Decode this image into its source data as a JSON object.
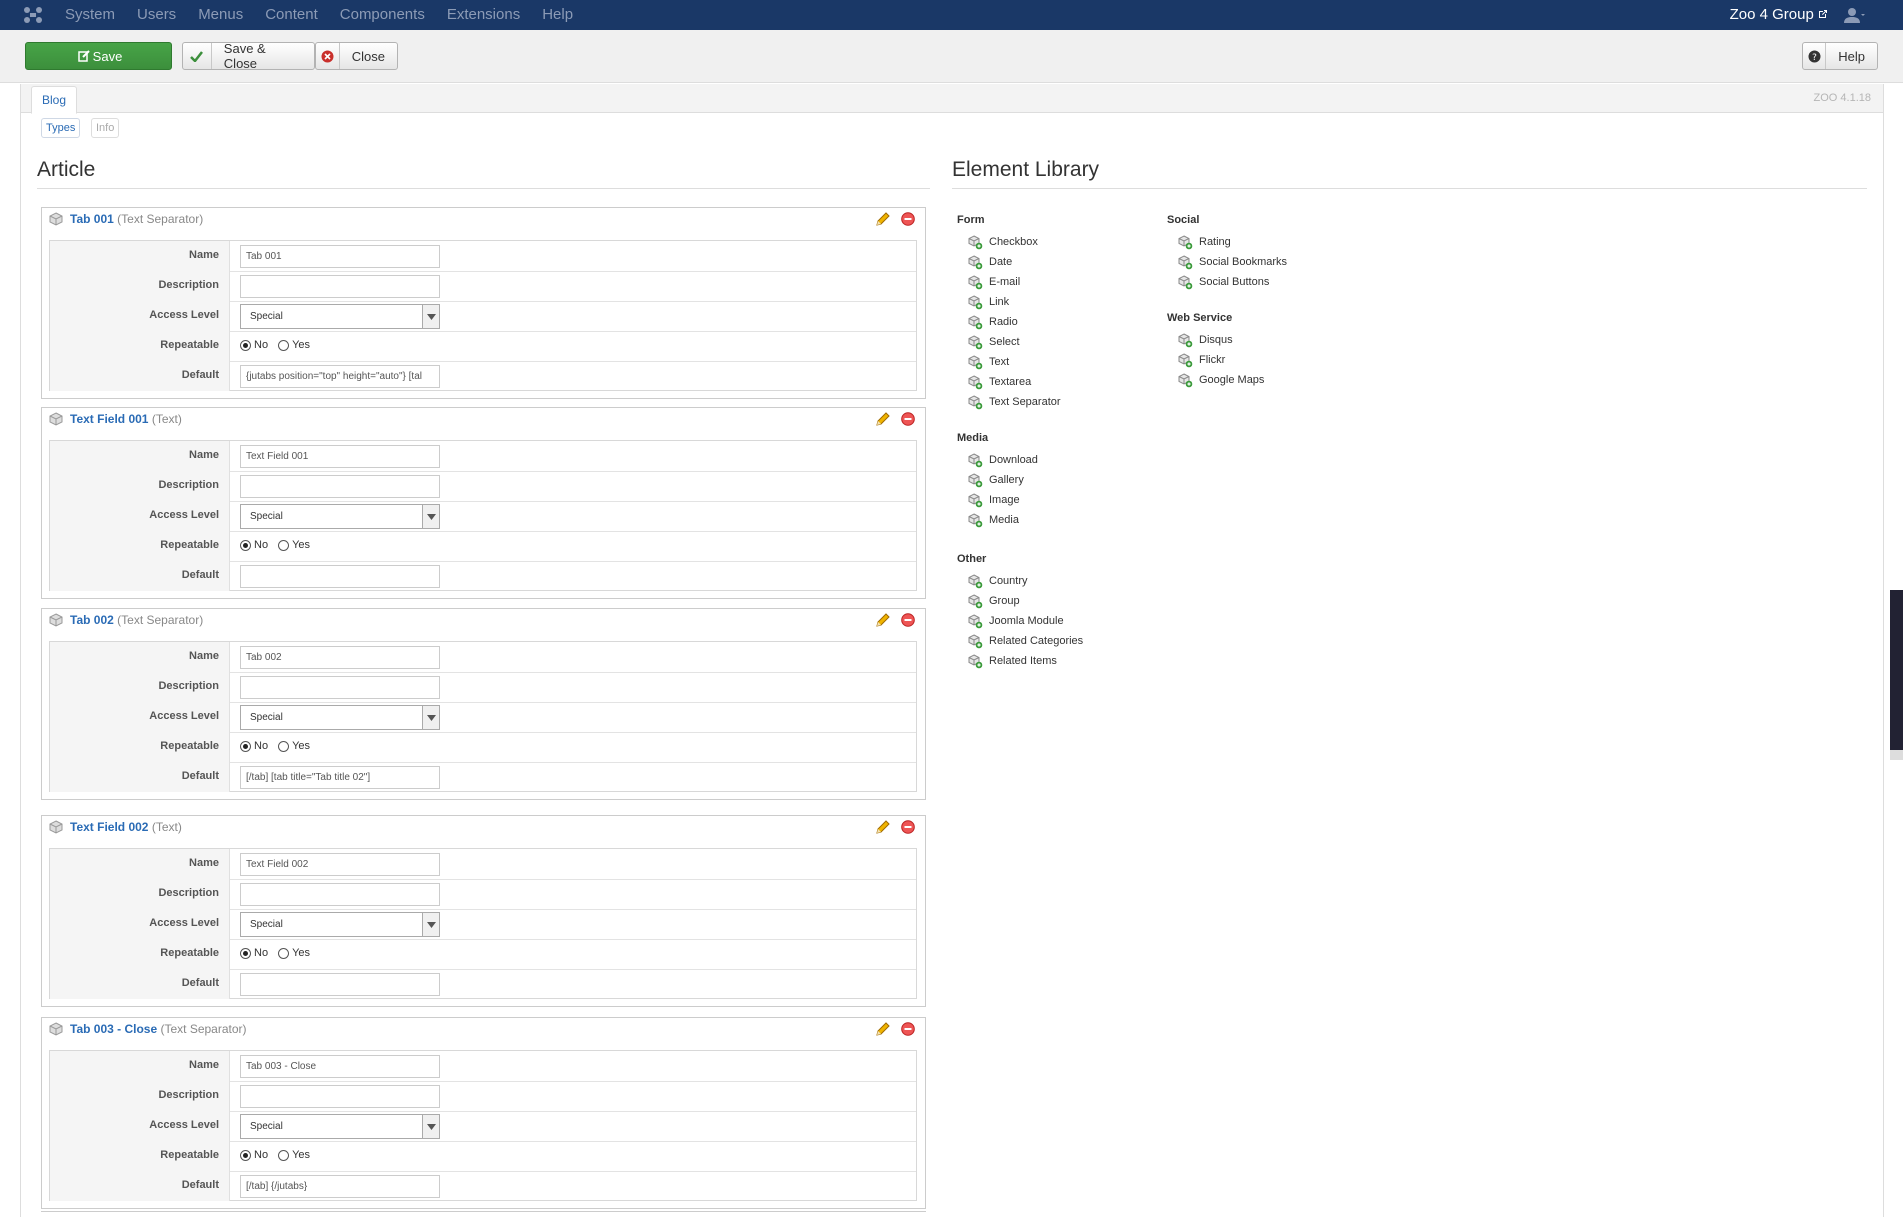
{
  "navbar": {
    "menu": [
      "System",
      "Users",
      "Menus",
      "Content",
      "Components",
      "Extensions",
      "Help"
    ],
    "site_name": "Zoo 4 Group"
  },
  "toolbar": {
    "save_label": "Save",
    "save_close_label": "Save & Close",
    "close_label": "Close",
    "help_label": "Help"
  },
  "app": {
    "tab_label": "Blog",
    "version": "ZOO 4.1.18",
    "subtabs": [
      "Types",
      "Info"
    ]
  },
  "article": {
    "heading": "Article",
    "field_labels": {
      "name": "Name",
      "description": "Description",
      "access": "Access Level",
      "repeatable": "Repeatable",
      "default": "Default"
    },
    "radio_no": "No",
    "radio_yes": "Yes",
    "elements": [
      {
        "name": "Tab 001",
        "type": "(Text Separator)",
        "name_value": "Tab 001",
        "description": "",
        "access": "Special",
        "repeatable": "No",
        "default": "{jutabs position=\"top\" height=\"auto\"} [tal"
      },
      {
        "name": "Text Field 001",
        "type": "(Text)",
        "name_value": "Text Field 001",
        "description": "",
        "access": "Special",
        "repeatable": "No",
        "default": ""
      },
      {
        "name": "Tab 002",
        "type": "(Text Separator)",
        "name_value": "Tab 002",
        "description": "",
        "access": "Special",
        "repeatable": "No",
        "default": "[/tab] [tab title=\"Tab title 02\"]"
      },
      {
        "name": "Text Field 002",
        "type": "(Text)",
        "name_value": "Text Field 002",
        "description": "",
        "access": "Special",
        "repeatable": "No",
        "default": ""
      },
      {
        "name": "Tab 003 - Close",
        "type": "(Text Separator)",
        "name_value": "Tab 003 - Close",
        "description": "",
        "access": "Special",
        "repeatable": "No",
        "default": "[/tab] {/jutabs}"
      }
    ]
  },
  "library": {
    "heading": "Element Library",
    "groups": [
      {
        "title": "Form",
        "items": [
          "Checkbox",
          "Date",
          "E-mail",
          "Link",
          "Radio",
          "Select",
          "Text",
          "Textarea",
          "Text Separator"
        ]
      },
      {
        "title": "Media",
        "items": [
          "Download",
          "Gallery",
          "Image",
          "Media"
        ]
      },
      {
        "title": "Other",
        "items": [
          "Country",
          "Group",
          "Joomla Module",
          "Related Categories",
          "Related Items"
        ]
      },
      {
        "title": "Social",
        "items": [
          "Rating",
          "Social Bookmarks",
          "Social Buttons"
        ]
      },
      {
        "title": "Web Service",
        "items": [
          "Disqus",
          "Flickr",
          "Google Maps"
        ]
      }
    ]
  }
}
